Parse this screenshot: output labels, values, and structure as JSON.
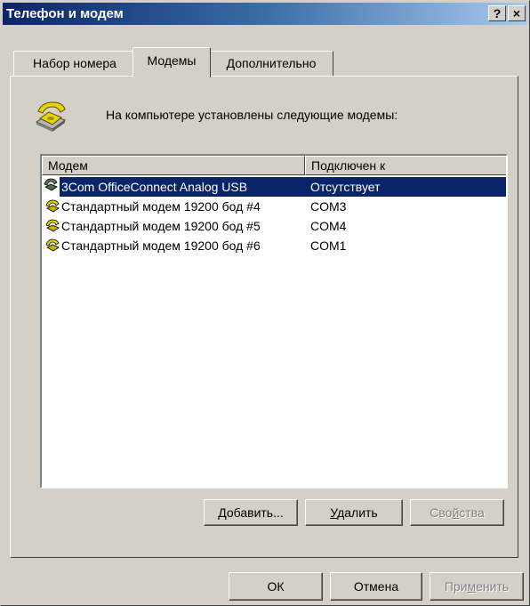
{
  "window": {
    "title": "Телефон и модем",
    "help_glyph": "?",
    "close_glyph": "×"
  },
  "tabs": [
    {
      "label": "Набор номера",
      "active": false
    },
    {
      "label": "Модемы",
      "active": true
    },
    {
      "label": "Дополнительно",
      "active": false
    }
  ],
  "info_text": "На компьютере установлены следующие модемы:",
  "list": {
    "columns": [
      "Модем",
      "Подключен к"
    ],
    "rows": [
      {
        "name": "3Com OfficeConnect Analog USB",
        "port": "Отсутствует",
        "selected": true,
        "icon": "modem-phone-icon"
      },
      {
        "name": "Стандартный модем 19200 бод #4",
        "port": "COM3",
        "selected": false,
        "icon": "modem-phone-icon"
      },
      {
        "name": "Стандартный модем 19200 бод #5",
        "port": "COM4",
        "selected": false,
        "icon": "modem-phone-icon"
      },
      {
        "name": "Стандартный модем 19200 бод #6",
        "port": "COM1",
        "selected": false,
        "icon": "modem-phone-icon"
      }
    ]
  },
  "buttons": {
    "add": {
      "prefix": "",
      "accel": "Д",
      "suffix": "обавить..."
    },
    "remove": {
      "prefix": "",
      "accel": "У",
      "suffix": "далить"
    },
    "properties": {
      "prefix": "Сво",
      "accel": "й",
      "suffix": "ства",
      "disabled": true
    },
    "ok": "ОК",
    "cancel": "Отмена",
    "apply": {
      "prefix": "При",
      "accel": "м",
      "suffix": "енить",
      "disabled": true
    }
  },
  "colors": {
    "titlebar_start": "#0a246a",
    "titlebar_end": "#a6caf0",
    "selection": "#0a246a",
    "face": "#d4d0c8",
    "phone_yellow": "#e8d400"
  }
}
